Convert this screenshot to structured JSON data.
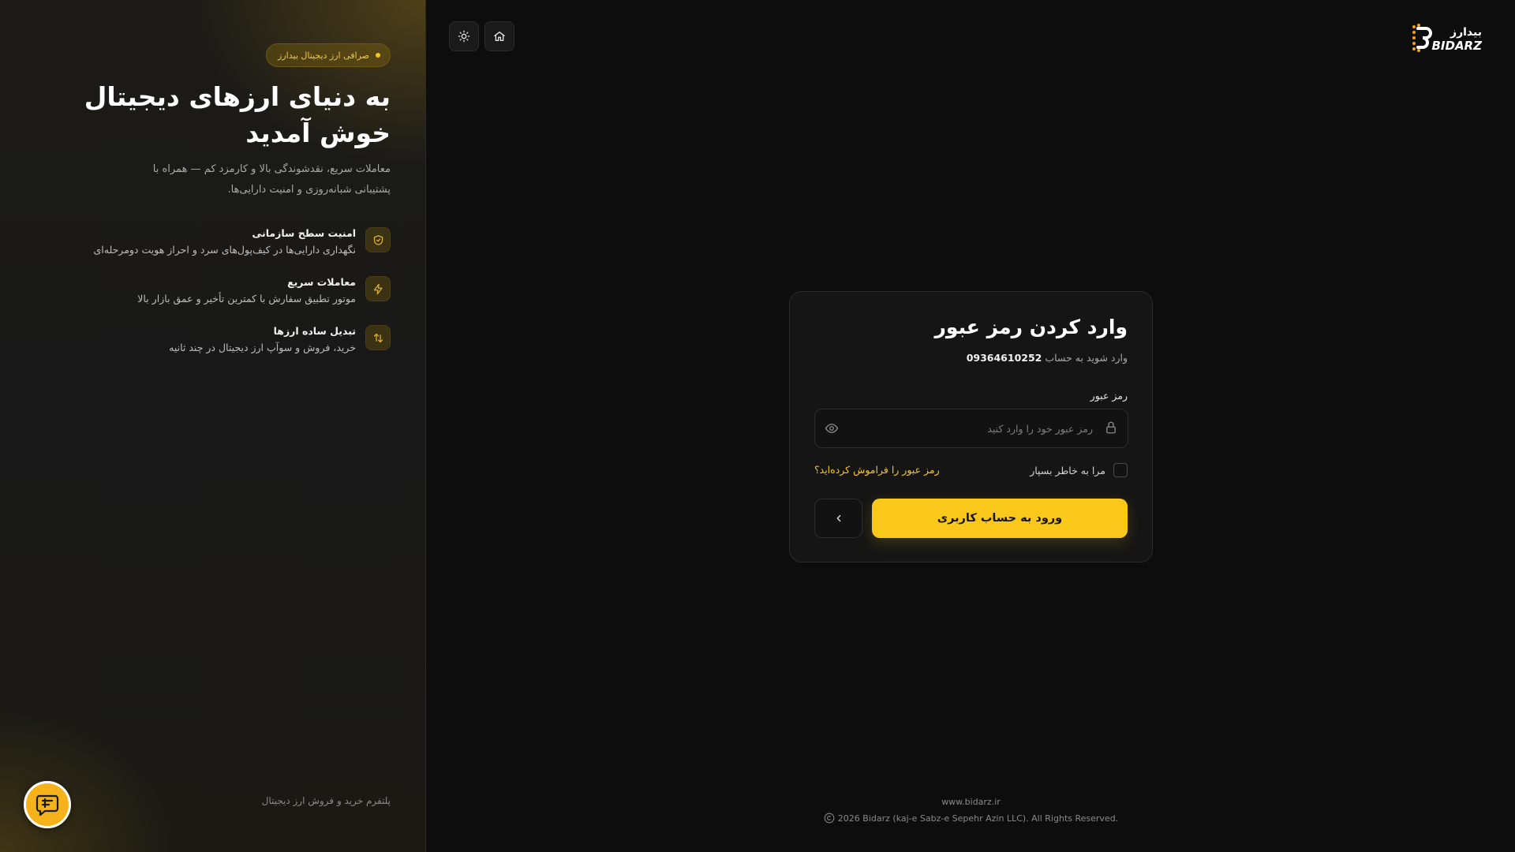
{
  "brand": {
    "logo_fa": "بیدارز",
    "logo_en": "BIDARZ",
    "accent": "#f9c81a"
  },
  "hero": {
    "badge": "صرافی ارز دیجیتال بیدارز",
    "title": "به دنیای ارزهای دیجیتال خوش آمدید",
    "subtitle": "معاملات سریع، نقدشوندگی بالا و کارمزد کم — همراه با پشتیبانی شبانه‌روزی و امنیت دارایی‌ها.",
    "features": [
      {
        "icon": "shield-icon",
        "title": "امنیت سطح سازمانی",
        "desc": "نگهداری دارایی‌ها در کیف‌پول‌های سرد و احراز هویت دومرحله‌ای"
      },
      {
        "icon": "lightning-icon",
        "title": "معاملات سریع",
        "desc": "موتور تطبیق سفارش با کمترین تأخیر و عمق بازار بالا"
      },
      {
        "icon": "swap-icon",
        "title": "تبدیل ساده ارزها",
        "desc": "خرید، فروش و سوآپ ارز دیجیتال در چند ثانیه"
      }
    ],
    "footer": "پلتفرم خرید و فروش ارز دیجیتال"
  },
  "login": {
    "title": "وارد کردن رمز عبور",
    "subtitle_prefix": "وارد شوید به حساب",
    "phone": "09364610252",
    "password_label": "رمز عبور",
    "password_placeholder": "رمز عبور خود را وارد کنید",
    "password_value": "",
    "remember_label": "مرا به خاطر بسپار",
    "forgot_label": "رمز عبور را فراموش کرده‌اید؟",
    "submit_label": "ورود به حساب کاربری"
  },
  "footer": {
    "url": "www.bidarz.ir",
    "copyright": "2026 Bidarz (kaj-e Sabz-e Sepehr Azin LLC). All Rights Reserved."
  }
}
